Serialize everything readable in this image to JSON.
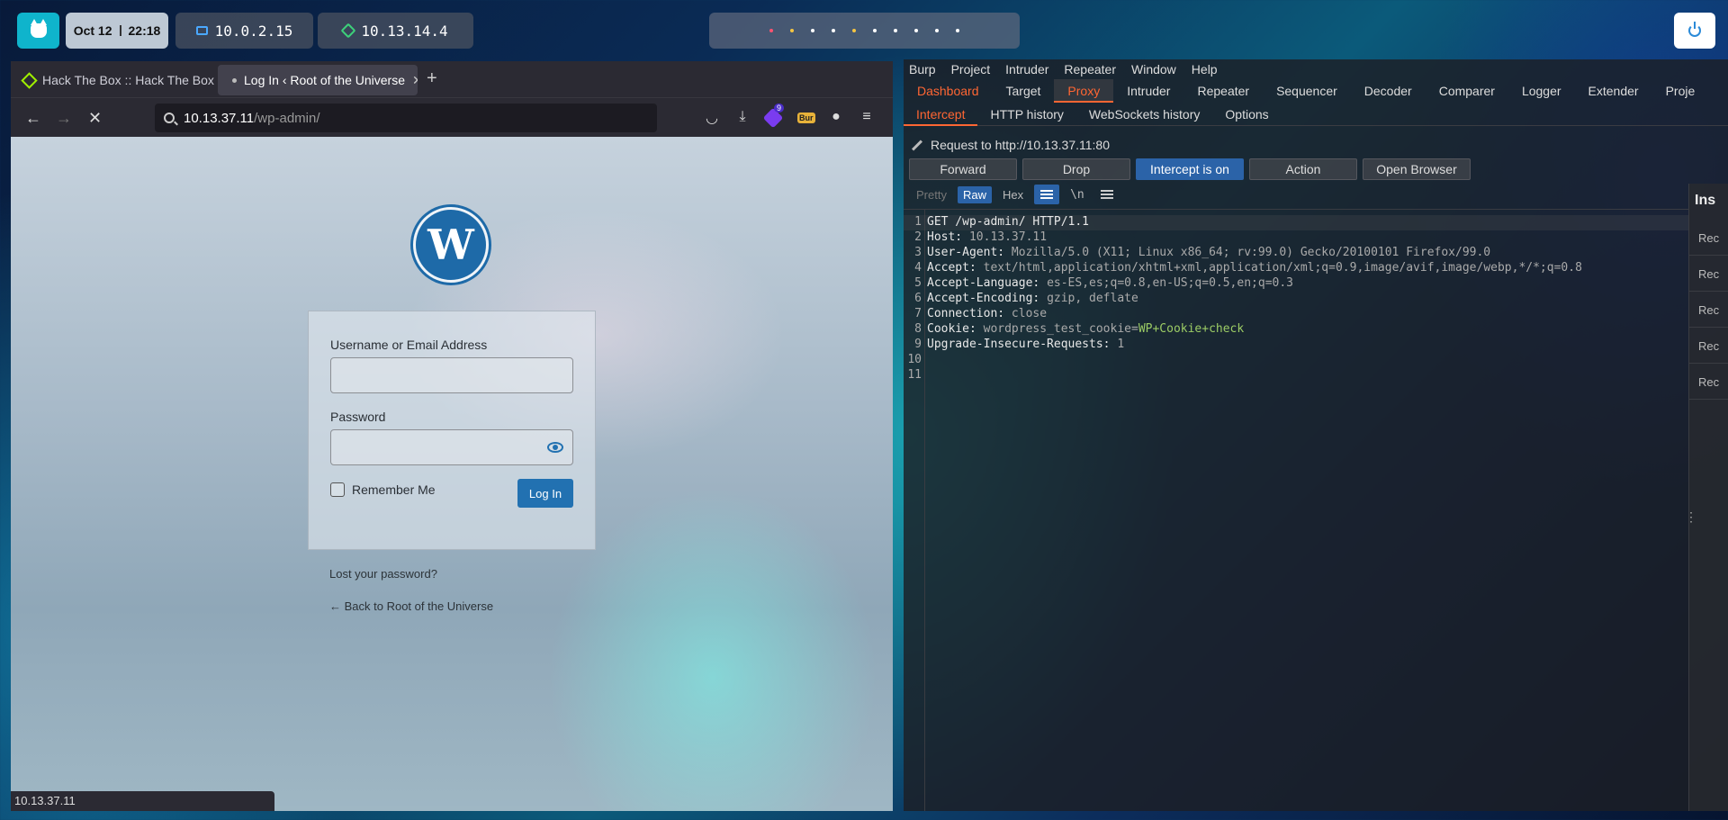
{
  "topbar": {
    "date": "Oct 12",
    "time": "22:18",
    "local_ip": "10.0.2.15",
    "vpn_ip": "10.13.14.4",
    "workspace_colors": [
      "#ff5370",
      "#f5c542",
      "#ffffff",
      "#ffffff",
      "#f5c542",
      "#ffffff",
      "#ffffff",
      "#ffffff",
      "#ffffff",
      "#ffffff"
    ]
  },
  "browser": {
    "tabs": [
      {
        "title": "Hack The Box :: Hack The Box",
        "icon": "htb-cube-icon"
      },
      {
        "title": "Log In ‹ Root of the Universe",
        "icon": "loading-dot-icon"
      }
    ],
    "url_host": "10.13.37.11",
    "url_path": "/wp-admin/",
    "extension_badge": "9",
    "extension_bur": "Bur",
    "status_text": "10.13.37.11"
  },
  "login": {
    "username_label": "Username or Email Address",
    "password_label": "Password",
    "remember_label": "Remember Me",
    "login_button": "Log In",
    "lost_password": "Lost your password?",
    "back_link": "← Back to Root of the Universe"
  },
  "burp": {
    "menu": [
      "Burp",
      "Project",
      "Intruder",
      "Repeater",
      "Window",
      "Help"
    ],
    "main_tabs": [
      "Dashboard",
      "Target",
      "Proxy",
      "Intruder",
      "Repeater",
      "Sequencer",
      "Decoder",
      "Comparer",
      "Logger",
      "Extender",
      "Proje"
    ],
    "sub_tabs": [
      "Intercept",
      "HTTP history",
      "WebSockets history",
      "Options"
    ],
    "request_to": "Request to http://10.13.37.11:80",
    "buttons": {
      "forward": "Forward",
      "drop": "Drop",
      "intercept": "Intercept is on",
      "action": "Action",
      "open_browser": "Open Browser"
    },
    "view_modes": {
      "pretty": "Pretty",
      "raw": "Raw",
      "hex": "Hex",
      "newline": "\\n"
    },
    "request_lines": [
      {
        "n": "1",
        "k": "GET /wp-admin/ HTTP/1.1",
        "v": ""
      },
      {
        "n": "2",
        "k": "Host: ",
        "v": "10.13.37.11"
      },
      {
        "n": "3",
        "k": "User-Agent: ",
        "v": "Mozilla/5.0 (X11; Linux x86_64; rv:99.0) Gecko/20100101 Firefox/99.0"
      },
      {
        "n": "4",
        "k": "Accept: ",
        "v": "text/html,application/xhtml+xml,application/xml;q=0.9,image/avif,image/webp,*/*;q=0.8"
      },
      {
        "n": "5",
        "k": "Accept-Language: ",
        "v": "es-ES,es;q=0.8,en-US;q=0.5,en;q=0.3"
      },
      {
        "n": "6",
        "k": "Accept-Encoding: ",
        "v": "gzip, deflate"
      },
      {
        "n": "7",
        "k": "Connection: ",
        "v": "close"
      },
      {
        "n": "8",
        "k": "Cookie: ",
        "v": "wordpress_test_cookie=",
        "v2": "WP+Cookie+check"
      },
      {
        "n": "9",
        "k": "Upgrade-Insecure-Requests: ",
        "v": "1"
      },
      {
        "n": "10",
        "k": "",
        "v": ""
      },
      {
        "n": "11",
        "k": "",
        "v": ""
      }
    ],
    "inspector_title": "Ins",
    "inspector_rows": [
      "Rec",
      "Rec",
      "Rec",
      "Rec",
      "Rec"
    ]
  }
}
